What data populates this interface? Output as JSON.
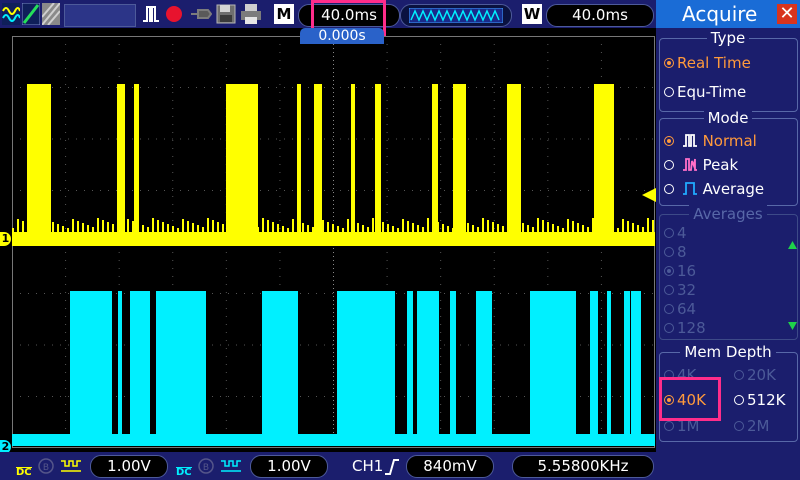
{
  "toolbar": {
    "mode_label": "M",
    "timebase": "40.0ms",
    "window_label": "W",
    "window_timebase": "40.0ms",
    "trigger_position": "0.000s"
  },
  "status_bar": {
    "ch1_coupling": "DC",
    "ch1_scale": "1.00V",
    "ch2_coupling": "DC",
    "ch2_scale": "1.00V",
    "trigger_source": "CH1",
    "trigger_level": "840mV",
    "frequency": "5.55800KHz"
  },
  "markers": {
    "ch1": "1",
    "ch2": "2"
  },
  "menu": {
    "title": "Acquire",
    "type": {
      "heading": "Type",
      "options": [
        "Real Time",
        "Equ-Time"
      ],
      "selected": "Real Time"
    },
    "mode": {
      "heading": "Mode",
      "options": [
        "Normal",
        "Peak",
        "Average"
      ],
      "selected": "Normal"
    },
    "averages": {
      "heading": "Averages",
      "options": [
        "4",
        "8",
        "16",
        "32",
        "64",
        "128"
      ],
      "selected": "16"
    },
    "mem_depth": {
      "heading": "Mem Depth",
      "options": [
        "4K",
        "20K",
        "40K",
        "512K",
        "1M",
        "2M"
      ],
      "selected": "40K"
    }
  },
  "colors": {
    "ch1": "#ffff00",
    "ch2": "#00f0ff",
    "highlight": "#ff2d8a",
    "selected": "#ff9a3c"
  }
}
